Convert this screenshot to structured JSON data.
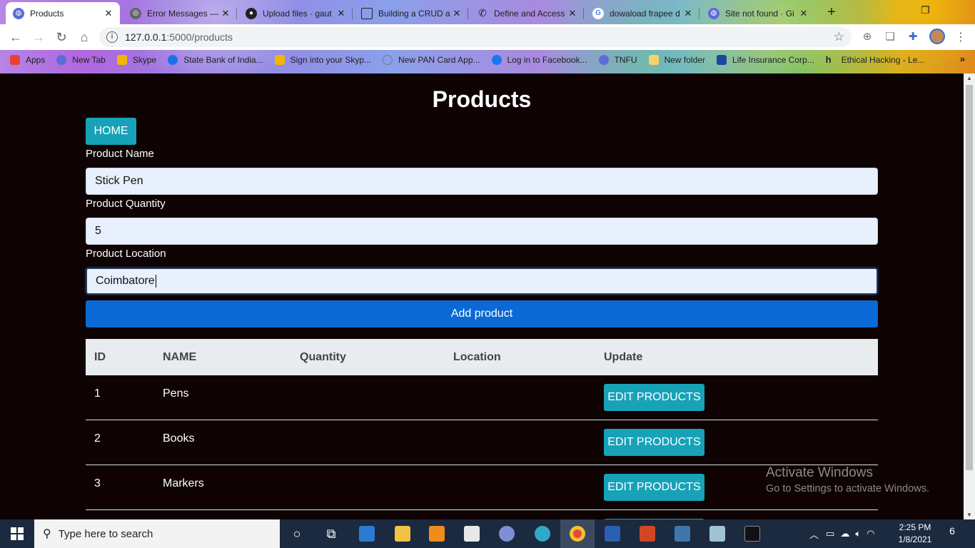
{
  "browser": {
    "tabs": [
      {
        "title": "Products",
        "active": true,
        "favicon": "globe-icon",
        "color": "#5b6bd8"
      },
      {
        "title": "Error Messages — ",
        "active": false,
        "favicon": "settings-icon",
        "color": "#5f6368"
      },
      {
        "title": "Upload files · gaut",
        "active": false,
        "favicon": "github-icon",
        "color": "#202124"
      },
      {
        "title": "Building a CRUD a",
        "active": false,
        "favicon": "page-icon",
        "color": "#202124"
      },
      {
        "title": "Define and Access",
        "active": false,
        "favicon": "phone-icon",
        "color": "#202124"
      },
      {
        "title": "dowaload frapee d",
        "active": false,
        "favicon": "google-icon",
        "color": "#4285f4"
      },
      {
        "title": "Site not found · Gi",
        "active": false,
        "favicon": "globe-icon",
        "color": "#5b6bd8"
      }
    ],
    "url_host": "127.0.0.1",
    "url_path": ":5000/products",
    "bookmarks": [
      {
        "label": "Apps",
        "color": "#e94235"
      },
      {
        "label": "New Tab",
        "color": "#5b6bd8"
      },
      {
        "label": "Skype",
        "color": "#f4b400"
      },
      {
        "label": "State Bank of India...",
        "color": "#1a73e8"
      },
      {
        "label": "Sign into your Skyp...",
        "color": "#f4b400"
      },
      {
        "label": "New PAN Card App...",
        "color": "#7a7a7a"
      },
      {
        "label": "Log in to Facebook...",
        "color": "#1877f2"
      },
      {
        "label": "TNFU",
        "color": "#5b6bd8"
      },
      {
        "label": "New folder",
        "color": "#f6d36b"
      },
      {
        "label": "Life Insurance Corp...",
        "color": "#1a4aa0"
      },
      {
        "label": "Ethical Hacking - Le...",
        "color": "#202124"
      }
    ],
    "bookmarks_more": "»"
  },
  "page": {
    "heading": "Products",
    "home_button": "HOME",
    "form": {
      "name_label": "Product Name",
      "name_value": "Stick Pen",
      "qty_label": "Product Quantity",
      "qty_value": "5",
      "loc_label": "Product Location",
      "loc_value": "Coimbatore",
      "submit_label": "Add product"
    },
    "table": {
      "headers": [
        "ID",
        "NAME",
        "Quantity",
        "Location",
        "Update"
      ],
      "rows": [
        {
          "id": "1",
          "name": "Pens",
          "quantity": "",
          "location": "",
          "action": "EDIT PRODUCTS"
        },
        {
          "id": "2",
          "name": "Books",
          "quantity": "",
          "location": "",
          "action": "EDIT PRODUCTS"
        },
        {
          "id": "3",
          "name": "Markers",
          "quantity": "",
          "location": "",
          "action": "EDIT PRODUCTS"
        }
      ]
    },
    "watermark": {
      "line1": "Activate Windows",
      "line2": "Go to Settings to activate Windows."
    }
  },
  "taskbar": {
    "search_placeholder": "Type here to search",
    "time": "2:25 PM",
    "date": "1/8/2021",
    "notification_count": "6"
  },
  "colors": {
    "page_bg": "#0e0203",
    "info_button": "#17a2b8",
    "primary_button": "#0b69d5",
    "input_bg": "#e8f0fe",
    "taskbar_bg": "#1c2a3f"
  }
}
